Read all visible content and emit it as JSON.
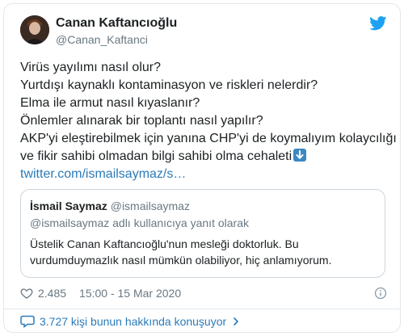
{
  "author": {
    "name": "Canan Kaftancıoğlu",
    "handle": "@Canan_Kaftanci"
  },
  "tweet": {
    "lines": [
      "Virüs yayılımı nasıl olur?",
      "Yurtdışı kaynaklı kontaminasyon ve riskleri nelerdir?",
      "Elma ile armut nasıl kıyaslanır?",
      "Önlemler alınarak bir toplantı nasıl yapılır?",
      "AKP'yi eleştirebilmek için yanına CHP'yi de koymalıyım kolaycılığı",
      "ve fikir sahibi olmadan bilgi sahibi olma cehaleti"
    ],
    "emoji": "arrow-down-emoji",
    "link": "twitter.com/ismailsaymaz/s…"
  },
  "quote": {
    "name": "İsmail Saymaz",
    "handle": "@ismailsaymaz",
    "reply_to": "@ismailsaymaz adlı kullanıcıya yanıt olarak",
    "lines": [
      "Üstelik Canan Kaftancıoğlu'nun mesleği doktorluk. Bu",
      "vurdumduymazlık nasıl mümkün olabiliyor, hiç anlamıyorum."
    ]
  },
  "meta": {
    "likes": "2.485",
    "timestamp": "15:00 - 15 Mar 2020"
  },
  "footer": {
    "conversation": "3.727 kişi bunun hakkında konuşuyor"
  },
  "colors": {
    "link": "#2b7bb9",
    "twitter_blue": "#1da1f2",
    "muted": "#697882",
    "border": "#e1e8ed"
  }
}
